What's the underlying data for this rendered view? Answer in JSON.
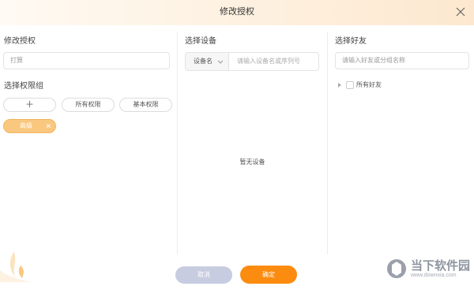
{
  "dialog": {
    "title": "修改授权"
  },
  "col1": {
    "title": "修改授权",
    "name_placeholder": "打算",
    "group_title": "选择权限组",
    "add_label": "＋",
    "all_perm_label": "所有权限",
    "basic_perm_label": "基本权限",
    "selected_tag": "高级",
    "selected_tag_close": "✕"
  },
  "col2": {
    "title": "选择设备",
    "select_value": "设备名",
    "search_placeholder": "请输入设备名或序列号",
    "empty_text": "暂无设备"
  },
  "col3": {
    "title": "选择好友",
    "search_placeholder": "请输入好友或分组名称",
    "tree_label": "所有好友"
  },
  "footer": {
    "cancel_label": "取消",
    "ok_label": "确定"
  },
  "watermark": {
    "name": "当下软件园",
    "url": "www.downxia.com"
  },
  "colors": {
    "accent": "#fb8c10",
    "tag": "#f9c77e",
    "cancel": "#c8cce0"
  }
}
